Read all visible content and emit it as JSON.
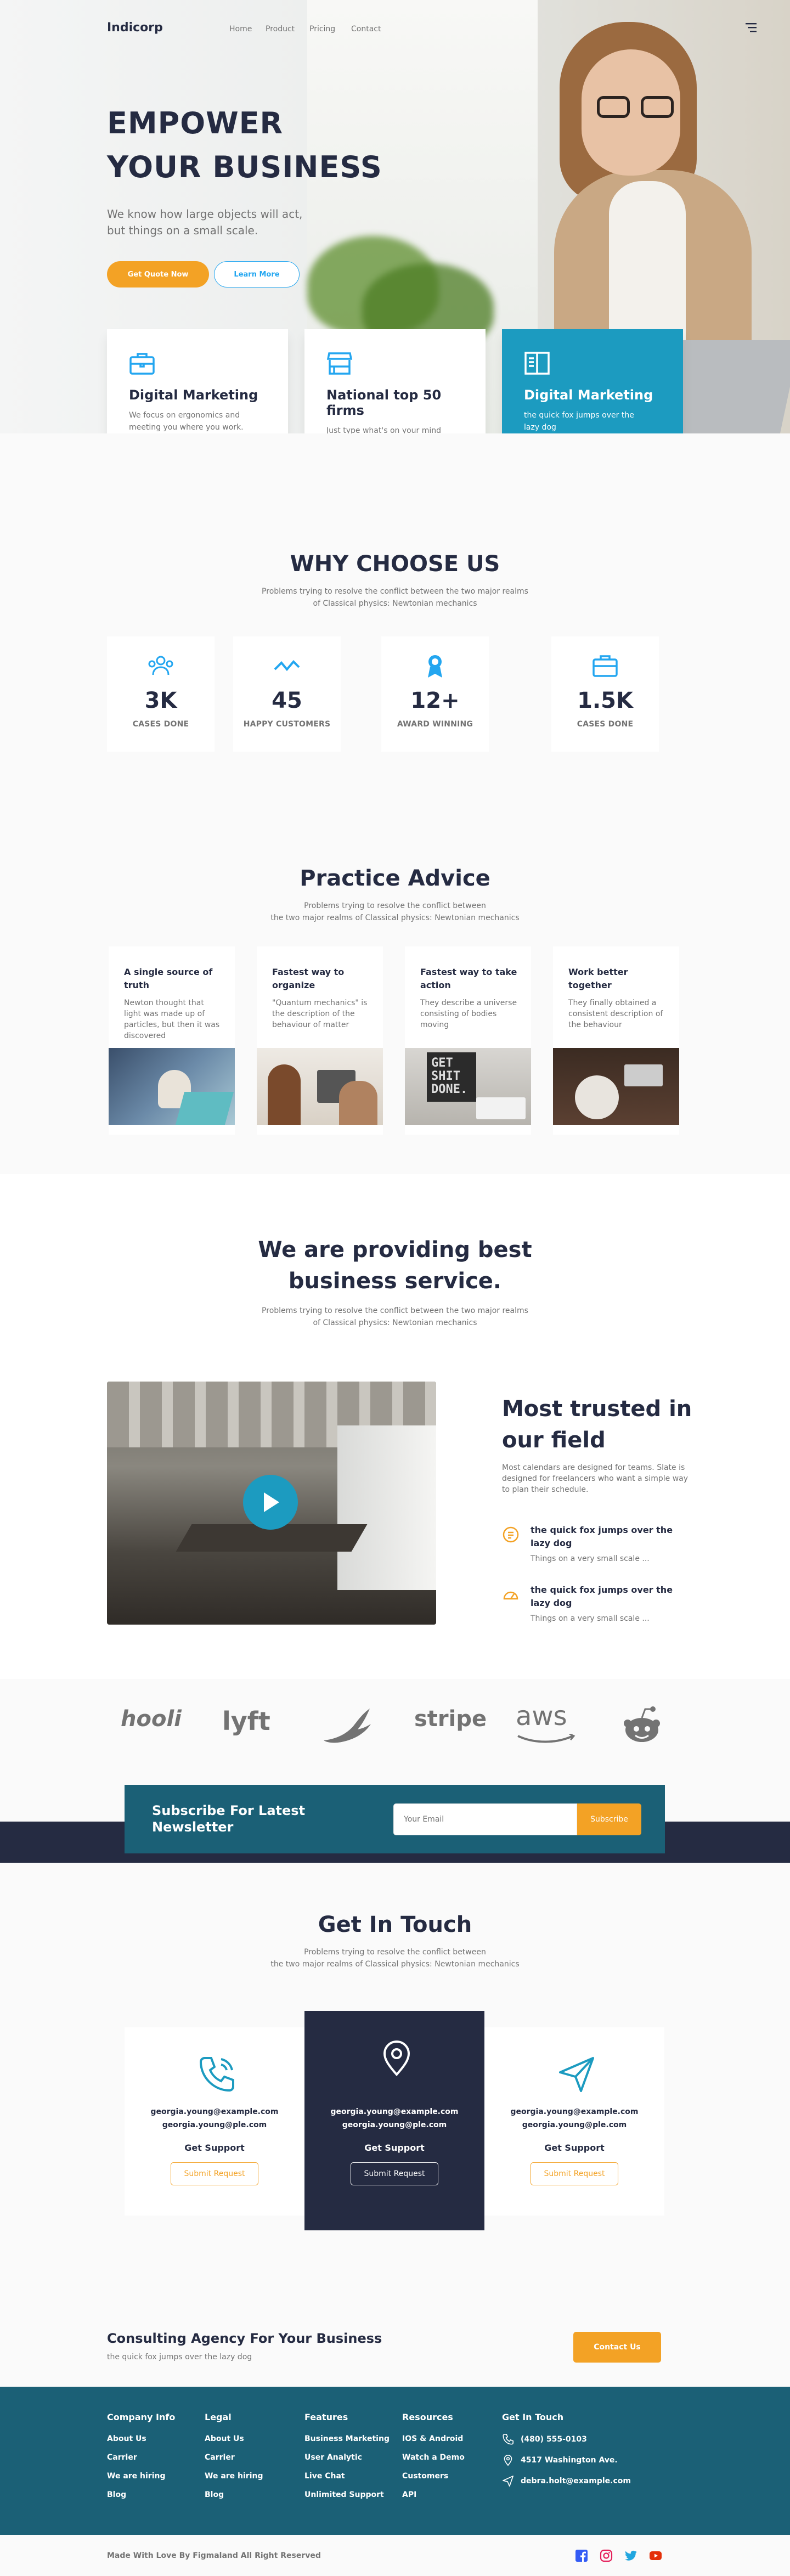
{
  "nav": {
    "logo": "Indicorp",
    "links": [
      "Home",
      "Product",
      "Pricing",
      "Contact"
    ]
  },
  "hero": {
    "title_line1": "EMPOWER",
    "title_line2": "YOUR BUSINESS",
    "desc_line1": "We know how large objects will act,",
    "desc_line2": "but things on a small scale.",
    "btn_quote": "Get Quote Now",
    "btn_learn": "Learn More"
  },
  "features": [
    {
      "title": "Digital Marketing",
      "text": "We focus on ergonomics and meeting you where you work."
    },
    {
      "title": "National top 50 firms",
      "text": "Just type what's on your mind and we'll get you there."
    },
    {
      "title": "Digital Marketing",
      "text": "the quick fox jumps over the lazy dog"
    }
  ],
  "why": {
    "title": "WHY CHOOSE US",
    "sub_line1": "Problems trying to resolve the conflict between the two major realms",
    "sub_line2": "of Classical physics: Newtonian mechanics",
    "stats": [
      {
        "num": "3K",
        "label": "CASES DONE",
        "icon": "users-icon"
      },
      {
        "num": "45",
        "label": "HAPPY CUSTOMERS",
        "icon": "trend-icon"
      },
      {
        "num": "12+",
        "label": "AWARD WINNING",
        "icon": "award-icon"
      },
      {
        "num": "1.5K",
        "label": "CASES DONE",
        "icon": "briefcase-icon"
      }
    ]
  },
  "practice": {
    "title": "Practice Advice",
    "sub_line1": "Problems trying to resolve the conflict between",
    "sub_line2": "the two major realms of Classical physics: Newtonian mechanics",
    "cards": [
      {
        "title": "A single source of truth",
        "text": "Newton thought that light was made up of particles, but then it was discovered"
      },
      {
        "title": "Fastest way to organize",
        "text": "\"Quantum mechanics\" is the description of the behaviour of matter"
      },
      {
        "title": "Fastest way to take action",
        "text": "They describe a universe consisting of bodies moving"
      },
      {
        "title": "Work better together",
        "text": "They finally obtained a consistent description of the behaviour"
      }
    ],
    "poster_text": "GET SHIT DONE."
  },
  "service": {
    "title_line1": "We are providing best",
    "title_line2": "business service.",
    "sub_line1": "Problems trying to resolve the conflict between the two major realms",
    "sub_line2": "of Classical physics: Newtonian mechanics"
  },
  "trusted": {
    "title": "Most trusted in our field",
    "desc": "Most calendars are designed for teams. Slate is designed for freelancers who want a simple way to plan their schedule.",
    "items": [
      {
        "title": "the quick fox jumps over the lazy dog",
        "text": "Things on a very small scale ..."
      },
      {
        "title": "the quick fox jumps over the lazy dog",
        "text": "Things on a very small scale ..."
      }
    ]
  },
  "logos": [
    "hooli",
    "lyft",
    "stripe",
    "aws"
  ],
  "newsletter": {
    "title": "Subscribe For Latest Newsletter",
    "placeholder": "Your Email",
    "button": "Subscribe"
  },
  "contact": {
    "title": "Get In Touch",
    "sub_line1": "Problems trying to resolve the conflict between",
    "sub_line2": "the two major realms of Classical physics: Newtonian mechanics",
    "cards": [
      {
        "email1": "georgia.young@example.com",
        "email2": "georgia.young@ple.com",
        "help": "Get Support",
        "button": "Submit Request"
      },
      {
        "email1": "georgia.young@example.com",
        "email2": "georgia.young@ple.com",
        "help": "Get Support",
        "button": "Submit Request"
      },
      {
        "email1": "georgia.young@example.com",
        "email2": "georgia.young@ple.com",
        "help": "Get Support",
        "button": "Submit Request"
      }
    ]
  },
  "consult": {
    "title": "Consulting Agency For Your Business",
    "sub": "the quick fox jumps over the lazy dog",
    "button": "Contact Us"
  },
  "footer": {
    "columns": [
      {
        "title": "Company Info",
        "links": [
          "About Us",
          "Carrier",
          "We are hiring",
          "Blog"
        ]
      },
      {
        "title": "Legal",
        "links": [
          "About Us",
          "Carrier",
          "We are hiring",
          "Blog"
        ]
      },
      {
        "title": "Features",
        "links": [
          "Business Marketing",
          "User Analytic",
          "Live Chat",
          "Unlimited Support"
        ]
      },
      {
        "title": "Resources",
        "links": [
          "IOS & Android",
          "Watch a Demo",
          "Customers",
          "API"
        ]
      }
    ],
    "contact_title": "Get In Touch",
    "phone": "(480) 555-0103",
    "address": "4517 Washington Ave.",
    "email": "debra.holt@example.com",
    "copyright": "Made With Love By Figmaland All Right Reserved"
  },
  "colors": {
    "primary": "#252B42",
    "accent": "#F3A225",
    "teal": "#1c9bc0",
    "footer_bg": "#1b6076",
    "muted": "#737373"
  }
}
